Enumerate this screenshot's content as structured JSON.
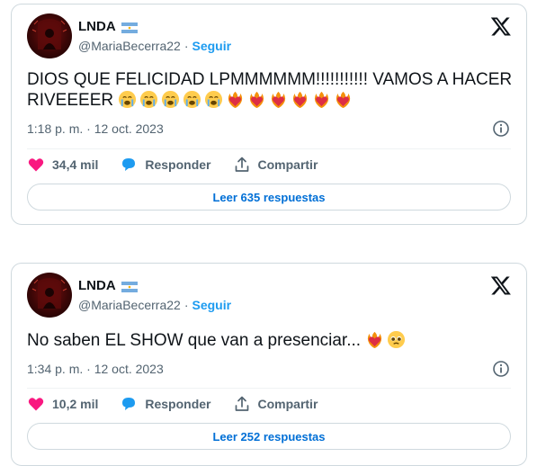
{
  "tweets": [
    {
      "name": "LNDA",
      "handle": "@MariaBecerra22",
      "separator": "·",
      "follow_label": "Seguir",
      "text": "DIOS QUE FELICIDAD LPMMMMMM!!!!!!!!!!! VAMOS A HACER RIVEEEER",
      "emojis": [
        "crying-face",
        "crying-face",
        "crying-face",
        "crying-face",
        "crying-face",
        "heart-on-fire",
        "heart-on-fire",
        "heart-on-fire",
        "heart-on-fire",
        "heart-on-fire",
        "heart-on-fire"
      ],
      "timestamp": "1:18 p. m. · 12 oct. 2023",
      "likes": "34,4 mil",
      "reply_label": "Responder",
      "share_label": "Compartir",
      "read_replies": "Leer 635 respuestas"
    },
    {
      "name": "LNDA",
      "handle": "@MariaBecerra22",
      "separator": "·",
      "follow_label": "Seguir",
      "text": "No saben EL SHOW que van a presenciar...",
      "emojis": [
        "heart-on-fire",
        "pleading-face"
      ],
      "timestamp": "1:34 p. m. · 12 oct. 2023",
      "likes": "10,2 mil",
      "reply_label": "Responder",
      "share_label": "Compartir",
      "read_replies": "Leer 252 respuestas"
    }
  ],
  "colors": {
    "like_heart": "#f91880",
    "reply_bubble": "#1d9bf0",
    "link_blue": "#1d9bf0",
    "read_replies_text": "#006fd6",
    "secondary_text": "#536471",
    "border": "#cfd9de"
  },
  "icons": [
    "x-logo-icon",
    "info-icon",
    "heart-icon",
    "reply-bubble-icon",
    "share-icon",
    "argentina-flag-icon"
  ]
}
